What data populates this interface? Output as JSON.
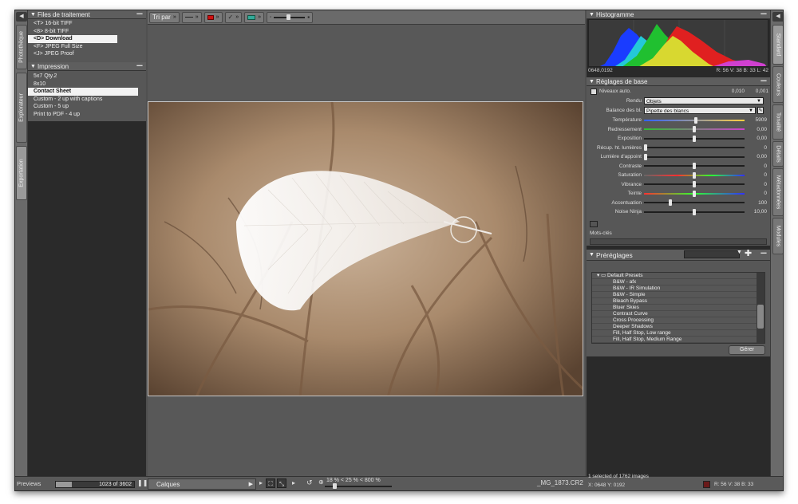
{
  "left_tabs": [
    "Photothèque",
    "Explorateur",
    "Exportation"
  ],
  "right_tabs": [
    "Standard",
    "Couleurs",
    "Tonalité",
    "Détails",
    "Métadonnées",
    "Modules"
  ],
  "processing_queue": {
    "title": "Files de traitement",
    "items": [
      "<T>  16-bit TIFF",
      "<8>  8-bit TIFF",
      "<D>  Download",
      "<F>  JPEG Full Size",
      "<J>  JPEG Proof"
    ],
    "selected": 2
  },
  "print_panel": {
    "title": "Impression",
    "items": [
      "5x7 Qty.2",
      "8x10",
      "Contact Sheet",
      "Custom - 2 up with captions",
      "Custom - 5 up",
      "Print to PDF - 4 up"
    ],
    "selected": 2
  },
  "toolbar": {
    "sort_label": "Tri par",
    "chevron": "»"
  },
  "bottom": {
    "previews_label": "Previews",
    "film_progress": 0.2,
    "film_count": "1023 of 3602",
    "layers_label": "Calques",
    "zoom_text": "18 % < 25 % < 800 %",
    "filename": "_MG_1873.CR2",
    "selection_info": "1 selected of 1762 images",
    "pixel_left": "X: 0648  Y: 0192",
    "pixel_right": "R:  56   V:   38   B:   33"
  },
  "histogram": {
    "title": "Histogramme",
    "readout_left": "0648,0192",
    "readout_right": "R: 56  V: 38  B: 33  L: 42"
  },
  "basic": {
    "title": "Réglages de base",
    "auto_label": "Niveaux auto.",
    "auto_val1": "0,010",
    "auto_val2": "0,001",
    "render_label": "Rendu",
    "render_value": "Objets",
    "wb_label": "Balance des bl.",
    "wb_value": "Pipette des blancs",
    "sliders": [
      {
        "label": "Température",
        "value": "5909",
        "pos": 0.52
      },
      {
        "label": "Redressement",
        "value": "0,00",
        "pos": 0.5
      },
      {
        "label": "Exposition",
        "value": "0,00",
        "pos": 0.5
      },
      {
        "label": "Récup. ht. lumières",
        "value": "0",
        "pos": 0.0
      },
      {
        "label": "Lumière d'appoint",
        "value": "0,00",
        "pos": 0.0
      },
      {
        "label": "Contraste",
        "value": "0",
        "pos": 0.5
      },
      {
        "label": "Saturation",
        "value": "0",
        "pos": 0.5
      },
      {
        "label": "Vibrance",
        "value": "0",
        "pos": 0.5
      },
      {
        "label": "Teinte",
        "value": "0",
        "pos": 0.5
      },
      {
        "label": "Accentuation",
        "value": "100",
        "pos": 0.25
      },
      {
        "label": "Noise Ninja",
        "value": "10,00",
        "pos": 0.5
      }
    ],
    "keywords_label": "Mots-clés"
  },
  "presets": {
    "title": "Préréglages",
    "root": "Default Presets",
    "items": [
      "B&W - afx",
      "B&W - IR Simulation",
      "B&W - Simple",
      "Bleach Bypass",
      "Bluer Skies",
      "Contrast Curve",
      "Cross Processing",
      "Deeper Shadows",
      "Fill, Half Stop, Low range",
      "Fill, Half Stop, Medium Range"
    ],
    "manage_label": "Gérer"
  }
}
